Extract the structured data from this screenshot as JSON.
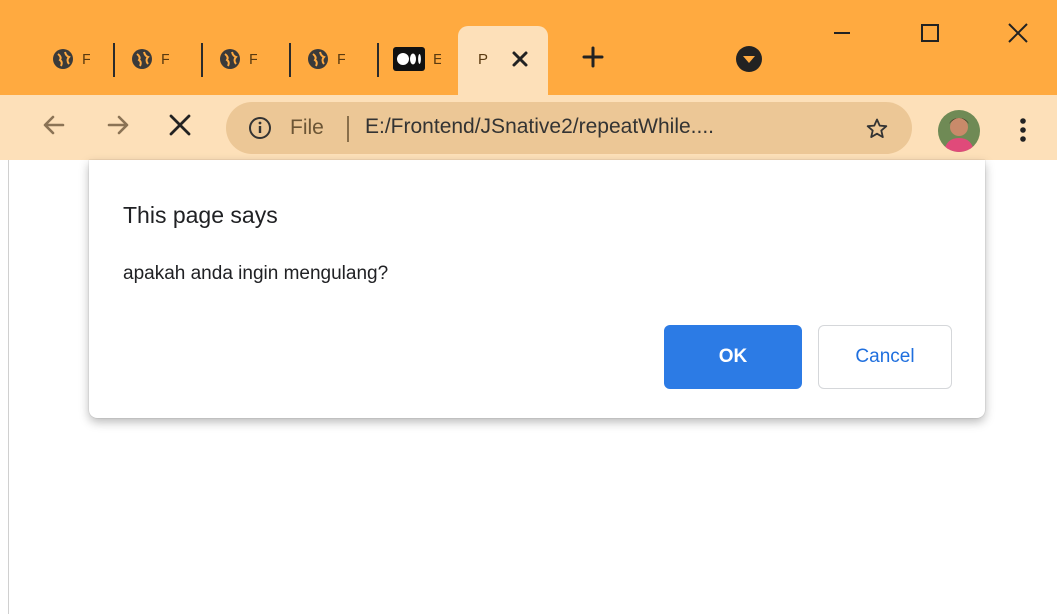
{
  "browser": {
    "tabs": [
      {
        "title": "F",
        "favicon": "globe-icon"
      },
      {
        "title": "F",
        "favicon": "globe-icon"
      },
      {
        "title": "F",
        "favicon": "globe-icon"
      },
      {
        "title": "F",
        "favicon": "globe-icon"
      },
      {
        "title": "E",
        "favicon": "medium-logo-icon"
      }
    ],
    "active_tab": {
      "title": "P"
    },
    "window_controls": [
      "minimize-icon",
      "maximize-icon",
      "close-icon"
    ],
    "colors": {
      "frame": "#ffaa40",
      "toolbar": "#fde0b9",
      "omnibox": "#ecc796"
    }
  },
  "toolbar": {
    "chip_label": "File",
    "url": "E:/Frontend/JSnative2/repeatWhile...."
  },
  "dialog": {
    "heading": "This page says",
    "message": "apakah anda ingin mengulang?",
    "ok_label": "OK",
    "cancel_label": "Cancel",
    "colors": {
      "ok_bg": "#2c7be5",
      "cancel_text": "#1f6fde"
    }
  }
}
